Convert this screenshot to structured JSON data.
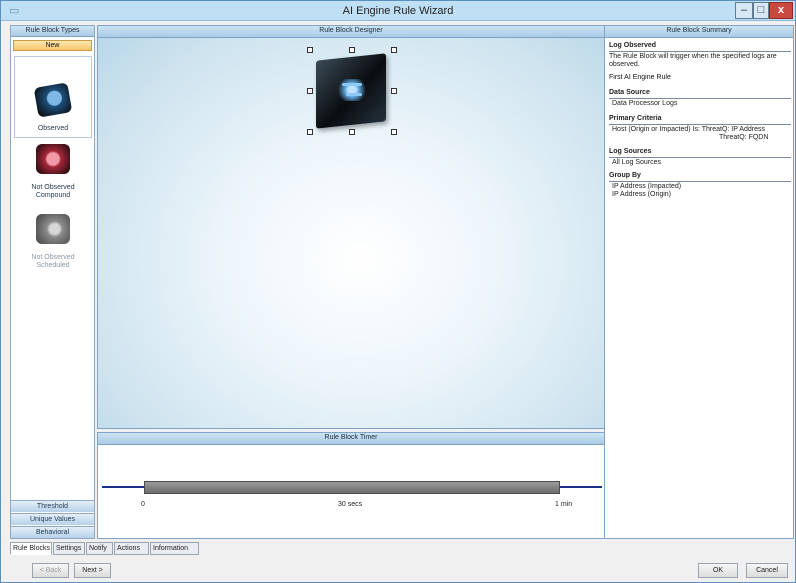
{
  "window": {
    "title": "AI Engine Rule Wizard",
    "minimize_glyph": "–",
    "maximize_glyph": "□",
    "close_glyph": "x"
  },
  "sidebar": {
    "header": "Rule Block Types",
    "section_label": "New",
    "blocks": [
      {
        "label": "Observed",
        "icon": "observed-cube-icon"
      },
      {
        "label": "Not Observed Compound",
        "icon": "not-observed-cube-icon"
      },
      {
        "label": "Not Observed Scheduled",
        "icon": "scheduled-cube-icon",
        "disabled": true
      }
    ],
    "categories": [
      "Threshold",
      "Unique Values",
      "Behavioral"
    ]
  },
  "designer": {
    "header": "Rule Block Designer",
    "block_icon": "observed-cube-icon"
  },
  "timer": {
    "header": "Rule Block Timer",
    "start_label": "0",
    "mid_label": "30 secs",
    "end_label": "1 min"
  },
  "summary": {
    "header": "Rule Block Summary",
    "log_observed_title": "Log Observed",
    "log_observed_text": "The Rule Block will trigger when the specified logs are observed.",
    "first_rule": "First AI Engine Rule",
    "data_source_title": "Data Source",
    "data_source_value": "Data Processor Logs",
    "primary_criteria_title": "Primary Criteria",
    "primary_criteria_line1": "Host (Origin or Impacted) Is: ThreatQ: IP Address",
    "primary_criteria_line2": "ThreatQ: FQDN",
    "log_sources_title": "Log Sources",
    "log_sources_value": "All Log Sources",
    "group_by_title": "Group By",
    "group_by_values": [
      "IP Address (Impacted)",
      "IP Address (Origin)"
    ]
  },
  "tabs": [
    "Rule Blocks",
    "Settings",
    "Notify",
    "Actions",
    "Information"
  ],
  "buttons": {
    "back": "< Back",
    "next": "Next >",
    "ok": "OK",
    "cancel": "Cancel"
  },
  "colors": {
    "title_bar": "#bfe0f4",
    "active_section": "#f6c66a",
    "timeline_line": "#1b2f8a",
    "close_button": "#c9483f"
  }
}
